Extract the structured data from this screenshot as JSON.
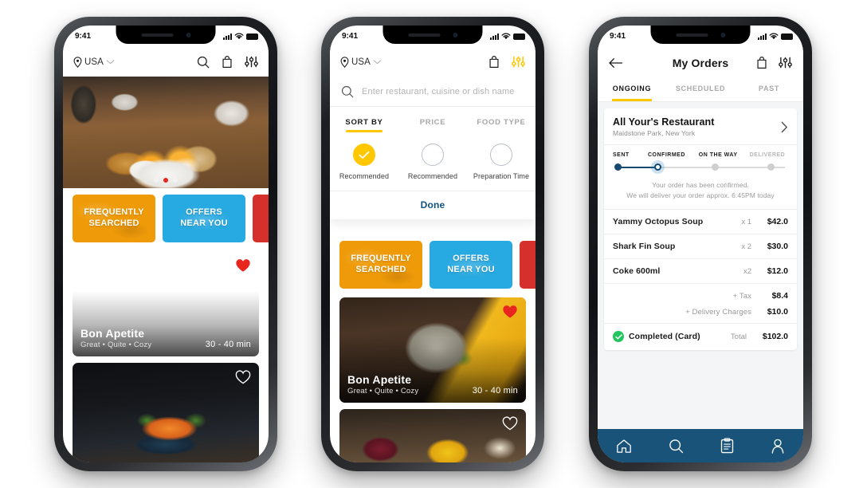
{
  "status_bar": {
    "time": "9:41",
    "signal_icon": "signal-bars-icon",
    "wifi_icon": "wifi-icon",
    "battery_icon": "battery-icon"
  },
  "phone1": {
    "header": {
      "location_label": "USA",
      "location_pin_icon": "location-pin-icon",
      "chevron_icon": "chevron-down-icon",
      "search_icon": "search-icon",
      "bag_icon": "shopping-bag-icon",
      "filter_icon": "filter-sliders-icon"
    },
    "carousel": {
      "dots": 3,
      "active_index": 1,
      "active_color": "#e8251f"
    },
    "categories": [
      {
        "line1": "FREQUENTLY",
        "line2": "SEARCHED",
        "color": "#ef9b09"
      },
      {
        "line1": "OFFERS",
        "line2": "NEAR YOU",
        "color": "#27a9e1"
      },
      {
        "line1": "",
        "line2": "",
        "color": "#d6302d"
      }
    ],
    "restaurants": [
      {
        "title": "Bon Apetite",
        "subtitle": "Great • Quite • Cozy",
        "time": "30 - 40 min",
        "favorite": true,
        "heart_icon": "heart-filled-icon"
      },
      {
        "title": "",
        "subtitle": "",
        "time": "",
        "favorite": false,
        "heart_icon": "heart-outline-icon"
      }
    ]
  },
  "phone2": {
    "header": {
      "location_label": "USA",
      "location_pin_icon": "location-pin-icon",
      "chevron_icon": "chevron-down-icon",
      "bag_icon": "shopping-bag-icon",
      "filter_icon": "filter-sliders-icon",
      "filter_icon_color": "#ffc700"
    },
    "search": {
      "placeholder": "Enter restaurant, cuisine  or dish name",
      "icon": "search-icon"
    },
    "filter": {
      "tabs": [
        {
          "label": "SORT BY",
          "active": true
        },
        {
          "label": "PRICE",
          "active": false
        },
        {
          "label": "FOOD TYPE",
          "active": false
        }
      ],
      "options": [
        {
          "label": "Recommended",
          "selected": true,
          "icon": "check-icon"
        },
        {
          "label": "Recommended",
          "selected": false,
          "icon": ""
        },
        {
          "label": "Preparation Time",
          "selected": false,
          "icon": ""
        }
      ],
      "done_label": "Done",
      "done_color": "#10527f",
      "accent_color": "#ffc700"
    },
    "categories": [
      {
        "line1": "FREQUENTLY",
        "line2": "SEARCHED",
        "color": "#ef9b09"
      },
      {
        "line1": "OFFERS",
        "line2": "NEAR YOU",
        "color": "#27a9e1"
      },
      {
        "line1": "",
        "line2": "",
        "color": "#d6302d"
      }
    ],
    "restaurants": [
      {
        "title": "Bon Apetite",
        "subtitle": "Great • Quite • Cozy",
        "time": "30 - 40 min",
        "favorite": true,
        "heart_icon": "heart-filled-icon"
      },
      {
        "title": "",
        "subtitle": "",
        "time": "",
        "favorite": false,
        "heart_icon": "heart-outline-icon"
      }
    ]
  },
  "phone3": {
    "header": {
      "title": "My Orders",
      "back_icon": "arrow-left-icon",
      "bag_icon": "shopping-bag-icon",
      "filter_icon": "filter-sliders-icon"
    },
    "tabs": [
      {
        "label": "ONGOING",
        "active": true
      },
      {
        "label": "SCHEDULED",
        "active": false
      },
      {
        "label": "PAST",
        "active": false
      }
    ],
    "order": {
      "restaurant_name": "All Your's Restaurant",
      "restaurant_address": "Maidstone Park, New York",
      "chevron_icon": "chevron-right-icon",
      "tracker": {
        "steps": [
          {
            "label": "SENT",
            "state": "done"
          },
          {
            "label": "CONFIRMED",
            "state": "current"
          },
          {
            "label": "ON THE WAY",
            "state": "pending"
          },
          {
            "label": "DELIVERED",
            "state": "pending"
          }
        ],
        "accent_color": "#15496e"
      },
      "message_line1": "Your order has been confirmed.",
      "message_line2": "We will deliver your order approx. 6:45PM today",
      "items": [
        {
          "name": "Yammy Octopus Soup",
          "qty": "x 1",
          "price": "$42.0"
        },
        {
          "name": "Shark Fin Soup",
          "qty": "x 2",
          "price": "$30.0"
        },
        {
          "name": "Coke 600ml",
          "qty": "x2",
          "price": "$12.0"
        }
      ],
      "fees": [
        {
          "label": "+ Tax",
          "price": "$8.4"
        },
        {
          "label": "+ Delivery Charges",
          "price": "$10.0"
        }
      ],
      "payment_status": "Completed (Card)",
      "payment_check_icon": "check-circle-icon",
      "total_label": "Total",
      "total_price": "$102.0"
    },
    "bottom_nav": {
      "background": "#1a5379",
      "items": [
        {
          "name": "home",
          "icon": "home-icon"
        },
        {
          "name": "search",
          "icon": "search-icon"
        },
        {
          "name": "orders",
          "icon": "clipboard-list-icon"
        },
        {
          "name": "profile",
          "icon": "person-icon"
        }
      ]
    }
  }
}
